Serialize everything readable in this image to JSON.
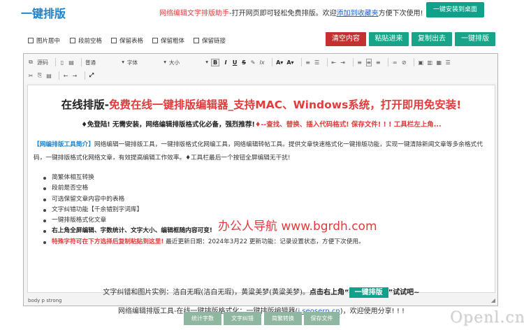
{
  "header": {
    "logo": "一键排版",
    "notice_red": "网络编辑文字排版助手",
    "notice_mid": "-打开网页即可轻松免费排版。欢迎",
    "notice_link": "添加到收藏夹",
    "notice_end": "方便下次使用!",
    "install_button": "一键安装到桌面"
  },
  "options": [
    {
      "label": "图片居中",
      "checked": false
    },
    {
      "label": "段前空格",
      "checked": false
    },
    {
      "label": "保留表格",
      "checked": false
    },
    {
      "label": "保留粗体",
      "checked": false
    },
    {
      "label": "保留链接",
      "checked": false
    }
  ],
  "actions": {
    "clear": "清空内容",
    "paste": "粘贴进来",
    "copy": "复制出去",
    "format": "一键排版"
  },
  "toolbar": {
    "source": "源码",
    "format_combo": "普通",
    "font_combo": "字体",
    "size_combo": "大小"
  },
  "content": {
    "title_prefix": "在线排版-",
    "title_main": "免费在线一键排版编辑器_支持MAC、Windows系统，打开即用免安装!",
    "sub_black": "♦免登陆! 无需安装，网络编辑排版格式化必备，强烈推荐!",
    "sub_red": "♦--查找、替换、插入代码格式! 保存文件! ! ! 工具栏左上角...",
    "intro_label": "【网编排版工具简介】",
    "intro_text": "网络编辑一键排版工具，一键排版格式化网编工具，网络编辑转帖工具。提供文章快速格式化一键排版功能，实现一键清除新闻文章等多余格式代码，一键排版格式化网络文章，有效提高编辑工作效率。♦工具栏最后一个按钮全屏编辑无干扰!",
    "bullets": [
      {
        "text": "简繁体相互转换",
        "style": "normal"
      },
      {
        "text": "段前是否空格",
        "style": "normal"
      },
      {
        "text": "可选保留文章内容中的表格",
        "style": "normal"
      },
      {
        "text": "文字纠错功能【千余错别字词库】",
        "style": "normal"
      },
      {
        "text": "一键排版格式化文章",
        "style": "normal"
      },
      {
        "text": "右上角全屏编辑、字数统计、文字大小、编辑框随内容可变!",
        "style": "bold"
      }
    ],
    "last_bullet_red": "特殊字符可在下方选择后复制粘贴到这里!",
    "last_bullet_rest": " 最近更新日期：2024年3月22 更新功能：记录设置状态，方便下次使用。",
    "watermark": "办公人导航 www.bgrdh.com",
    "example_plain": "文字纠错和图片实例：洁白无暇(洁白无瑕)，黄粱美梦(黄粱美梦)。",
    "example_bold": "点击右上角“",
    "example_pill": "一键排版",
    "example_end": "”试试吧~",
    "footer_text": "网络编辑排版工具-在线一键排版格式化：一键排版编辑器(",
    "footer_link": "i.seoserp.cn",
    "footer_end": ")，欢迎使用分享! ! !"
  },
  "statusbar": "body  p  strong",
  "bottom_buttons": [
    "统计字数",
    "文字纠错",
    "简繁转换",
    "保存文件"
  ],
  "brand": "Openl.cn"
}
